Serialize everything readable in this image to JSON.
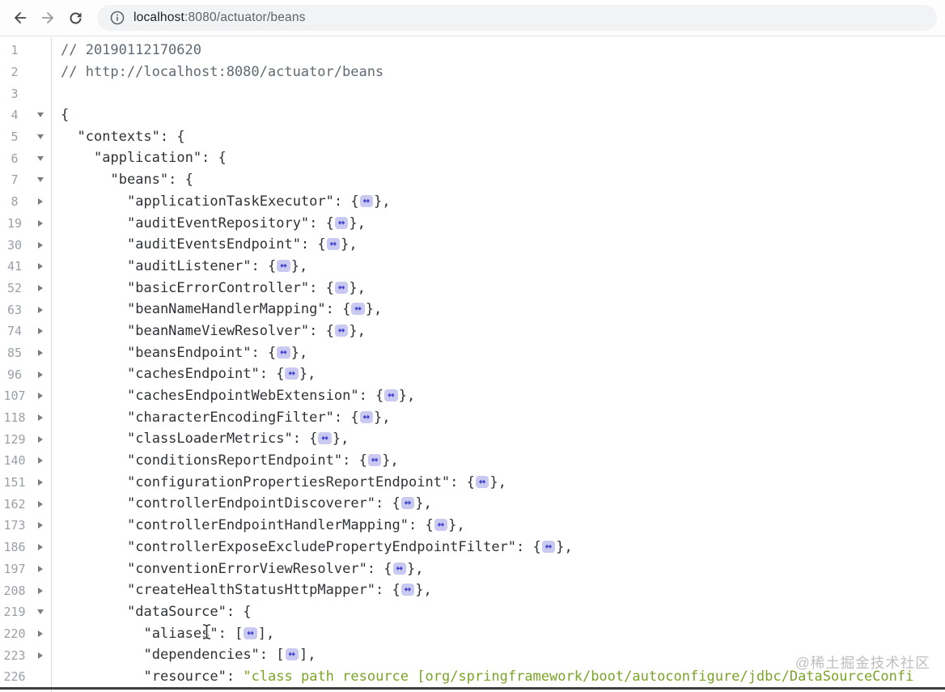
{
  "browser": {
    "url_host": "localhost",
    "url_rest": ":8080/actuator/beans",
    "icons": {
      "back": "back-arrow-icon",
      "forward": "forward-arrow-icon",
      "reload": "reload-icon",
      "info": "info-circle-icon"
    }
  },
  "watermark": {
    "text": "@稀土掘金技术社区"
  },
  "colors": {
    "string_green": "#7ba428",
    "pill_bg": "#c9c9f2",
    "pill_arrow": "#4040cf",
    "comment": "#5f6a73",
    "line_number": "#9aa0a6"
  },
  "viewer": {
    "collapsed_marker_icon": "double-headed-arrow",
    "rows": [
      {
        "num": "1",
        "arrow": "none",
        "indent": 0,
        "segs": [
          [
            "comment",
            "// 20190112170620"
          ]
        ]
      },
      {
        "num": "2",
        "arrow": "none",
        "indent": 0,
        "segs": [
          [
            "comment",
            "// http://localhost:8080/actuator/beans"
          ]
        ]
      },
      {
        "num": "3",
        "arrow": "none",
        "indent": 0,
        "segs": []
      },
      {
        "num": "4",
        "arrow": "down",
        "indent": 0,
        "segs": [
          [
            "plain",
            "{"
          ]
        ]
      },
      {
        "num": "5",
        "arrow": "down",
        "indent": 1,
        "segs": [
          [
            "plain",
            "\"contexts\": {"
          ]
        ]
      },
      {
        "num": "6",
        "arrow": "down",
        "indent": 2,
        "segs": [
          [
            "plain",
            "\"application\": {"
          ]
        ]
      },
      {
        "num": "7",
        "arrow": "down",
        "indent": 3,
        "segs": [
          [
            "plain",
            "\"beans\": {"
          ]
        ]
      },
      {
        "num": "8",
        "arrow": "right",
        "indent": 4,
        "key": "applicationTaskExecutor",
        "collapsed": "obj"
      },
      {
        "num": "19",
        "arrow": "right",
        "indent": 4,
        "key": "auditEventRepository",
        "collapsed": "obj"
      },
      {
        "num": "30",
        "arrow": "right",
        "indent": 4,
        "key": "auditEventsEndpoint",
        "collapsed": "obj"
      },
      {
        "num": "41",
        "arrow": "right",
        "indent": 4,
        "key": "auditListener",
        "collapsed": "obj"
      },
      {
        "num": "52",
        "arrow": "right",
        "indent": 4,
        "key": "basicErrorController",
        "collapsed": "obj"
      },
      {
        "num": "63",
        "arrow": "right",
        "indent": 4,
        "key": "beanNameHandlerMapping",
        "collapsed": "obj"
      },
      {
        "num": "74",
        "arrow": "right",
        "indent": 4,
        "key": "beanNameViewResolver",
        "collapsed": "obj"
      },
      {
        "num": "85",
        "arrow": "right",
        "indent": 4,
        "key": "beansEndpoint",
        "collapsed": "obj"
      },
      {
        "num": "96",
        "arrow": "right",
        "indent": 4,
        "key": "cachesEndpoint",
        "collapsed": "obj"
      },
      {
        "num": "107",
        "arrow": "right",
        "indent": 4,
        "key": "cachesEndpointWebExtension",
        "collapsed": "obj"
      },
      {
        "num": "118",
        "arrow": "right",
        "indent": 4,
        "key": "characterEncodingFilter",
        "collapsed": "obj"
      },
      {
        "num": "129",
        "arrow": "right",
        "indent": 4,
        "key": "classLoaderMetrics",
        "collapsed": "obj"
      },
      {
        "num": "140",
        "arrow": "right",
        "indent": 4,
        "key": "conditionsReportEndpoint",
        "collapsed": "obj"
      },
      {
        "num": "151",
        "arrow": "right",
        "indent": 4,
        "key": "configurationPropertiesReportEndpoint",
        "collapsed": "obj"
      },
      {
        "num": "162",
        "arrow": "right",
        "indent": 4,
        "key": "controllerEndpointDiscoverer",
        "collapsed": "obj"
      },
      {
        "num": "173",
        "arrow": "right",
        "indent": 4,
        "key": "controllerEndpointHandlerMapping",
        "collapsed": "obj"
      },
      {
        "num": "186",
        "arrow": "right",
        "indent": 4,
        "key": "controllerExposeExcludePropertyEndpointFilter",
        "collapsed": "obj"
      },
      {
        "num": "197",
        "arrow": "right",
        "indent": 4,
        "key": "conventionErrorViewResolver",
        "collapsed": "obj"
      },
      {
        "num": "208",
        "arrow": "right",
        "indent": 4,
        "key": "createHealthStatusHttpMapper",
        "collapsed": "obj"
      },
      {
        "num": "219",
        "arrow": "down",
        "indent": 4,
        "segs": [
          [
            "plain",
            "\"dataSource\": {"
          ]
        ]
      },
      {
        "num": "220",
        "arrow": "right",
        "indent": 5,
        "key": "aliases",
        "collapsed": "arr"
      },
      {
        "num": "223",
        "arrow": "right",
        "indent": 5,
        "key": "dependencies",
        "collapsed": "arr"
      },
      {
        "num": "226",
        "arrow": "none",
        "indent": 5,
        "segs": [
          [
            "plain",
            "\"resource\": "
          ],
          [
            "green",
            "\"class path resource [org/springframework/boot/autoconfigure/jdbc/DataSourceConfi"
          ]
        ]
      }
    ]
  }
}
